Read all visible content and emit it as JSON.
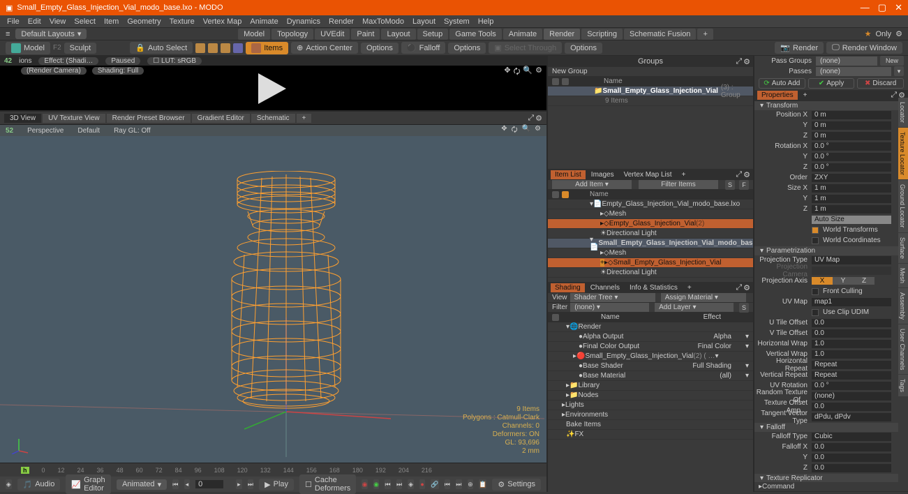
{
  "title": "Small_Empty_Glass_Injection_Vial_modo_base.lxo - MODO",
  "menus": [
    "File",
    "Edit",
    "View",
    "Select",
    "Item",
    "Geometry",
    "Texture",
    "Vertex Map",
    "Animate",
    "Dynamics",
    "Render",
    "MaxToModo",
    "Layout",
    "System",
    "Help"
  ],
  "layout_dropdown": "Default Layouts",
  "layout_tabs": [
    "Model",
    "Topology",
    "UVEdit",
    "Paint",
    "Layout",
    "Setup",
    "Game Tools",
    "Animate",
    "Render",
    "Scripting",
    "Schematic Fusion"
  ],
  "only_btn": "Only",
  "tools": {
    "model": "Model",
    "f2": "F2",
    "sculpt": "Sculpt",
    "auto_select": "Auto Select",
    "items": "Items",
    "action_center": "Action Center",
    "options1": "Options",
    "falloff": "Falloff",
    "options2": "Options",
    "select_through": "Select Through",
    "options3": "Options",
    "render": "Render",
    "render_window": "Render Window"
  },
  "preview": {
    "options_label": "ions",
    "effect": "Effect: (Shadi…",
    "paused": "Paused",
    "lut": "LUT: sRGB",
    "camera": "(Render Camera)",
    "shading": "Shading: Full",
    "counter": "42"
  },
  "view_tabs": [
    "3D View",
    "UV Texture View",
    "Render Preset Browser",
    "Gradient Editor",
    "Schematic"
  ],
  "viewport": {
    "perspective": "Perspective",
    "default": "Default",
    "raygl": "Ray GL: Off",
    "counter": "52",
    "stats": {
      "items": "9 Items",
      "polygons": "Polygons : Catmull-Clark",
      "channels": "Channels: 0",
      "deformers": "Deformers: ON",
      "gl": "GL: 93,696",
      "mem": "2 mm"
    }
  },
  "timeline_ticks": [
    "0",
    "12",
    "24",
    "36",
    "48",
    "60",
    "72",
    "84",
    "96",
    "108",
    "120",
    "132",
    "144",
    "156",
    "168",
    "180",
    "192",
    "204",
    "216"
  ],
  "bottombar": {
    "audio": "Audio",
    "graph": "Graph Editor",
    "animated": "Animated",
    "frame": "0",
    "play": "Play",
    "cache": "Cache Deformers",
    "settings": "Settings"
  },
  "groups": {
    "title": "Groups",
    "new_group": "New Group",
    "name_hdr": "Name",
    "item_name": "Small_Empty_Glass_Injection_Vial",
    "item_suffix": "(3) : Group",
    "item_count": "9 Items"
  },
  "item_tabs": [
    "Item List",
    "Images",
    "Vertex Map List"
  ],
  "item_list": {
    "add": "Add Item",
    "filter": "Filter Items",
    "s": "S",
    "f": "F",
    "name_hdr": "Name",
    "items": [
      {
        "name": "Empty_Glass_Injection_Vial_modo_base.lxo",
        "level": 1,
        "sel": false
      },
      {
        "name": "Mesh",
        "level": 2,
        "sel": false
      },
      {
        "name": "Empty_Glass_Injection_Vial",
        "suffix": "(2)",
        "level": 2,
        "sel": true
      },
      {
        "name": "Directional Light",
        "level": 2,
        "sel": false
      },
      {
        "name": "Small_Empty_Glass_Injection_Vial_modo_base.lxo",
        "level": 1,
        "sel": false,
        "bold": true
      },
      {
        "name": "Mesh",
        "level": 2,
        "sel": false
      },
      {
        "name": "Small_Empty_Glass_Injection_Vial",
        "level": 2,
        "sel": true,
        "hot": true
      },
      {
        "name": "Directional Light",
        "level": 2,
        "sel": false
      }
    ]
  },
  "shade_tabs": [
    "Shading",
    "Channels",
    "Info & Statistics"
  ],
  "shading": {
    "view": "View",
    "shader_tree": "Shader Tree",
    "assign": "Assign Material",
    "filter": "Filter",
    "filter_val": "(none)",
    "add_layer": "Add Layer",
    "s": "S",
    "name": "Name",
    "effect": "Effect",
    "rows": [
      {
        "name": "Render",
        "effect": ""
      },
      {
        "name": "Alpha Output",
        "effect": "Alpha"
      },
      {
        "name": "Final Color Output",
        "effect": "Final Color"
      },
      {
        "name": "Small_Empty_Glass_Injection_Vial",
        "suffix": "(2) ( …",
        "effect": ""
      },
      {
        "name": "Base Shader",
        "effect": "Full Shading"
      },
      {
        "name": "Base Material",
        "effect": "(all)"
      },
      {
        "name": "Library",
        "effect": ""
      },
      {
        "name": "Nodes",
        "effect": ""
      },
      {
        "name": "Lights",
        "effect": ""
      },
      {
        "name": "Environments",
        "effect": ""
      },
      {
        "name": "Bake Items",
        "effect": ""
      },
      {
        "name": "FX",
        "effect": ""
      }
    ]
  },
  "right": {
    "pass_groups": "Pass Groups",
    "pg_val": "(none)",
    "new": "New",
    "passes": "Passes",
    "p_val": "(none)",
    "auto_add": "Auto Add",
    "apply": "Apply",
    "discard": "Discard",
    "properties": "Properties",
    "transform": "Transform",
    "pos": {
      "label": "Position X",
      "x": "0 m",
      "y": "0 m",
      "z": "0 m"
    },
    "rot": {
      "label": "Rotation X",
      "x": "0.0 °",
      "y": "0.0 °",
      "z": "0.0 °"
    },
    "order": "Order",
    "order_val": "ZXY",
    "size": {
      "label": "Size X",
      "x": "1 m",
      "y": "1 m",
      "z": "1 m"
    },
    "auto_size": "Auto Size",
    "world_transforms": "World Transforms",
    "world_coords": "World Coordinates",
    "parametrization": "Parametrization",
    "proj_type": "Projection Type",
    "proj_type_val": "UV Map",
    "proj_camera": "Projection Camera",
    "proj_axis": "Projection Axis",
    "axis_x": "X",
    "axis_y": "Y",
    "axis_z": "Z",
    "front_culling": "Front Culling",
    "uv_map": "UV Map",
    "uv_map_val": "map1",
    "use_clip": "Use Clip UDIM",
    "u_tile": "U Tile Offset",
    "u_tile_val": "0.0",
    "v_tile": "V Tile Offset",
    "v_tile_val": "0.0",
    "h_wrap": "Horizontal Wrap",
    "h_wrap_val": "1.0",
    "v_wrap": "Vertical Wrap",
    "v_wrap_val": "1.0",
    "h_repeat": "Horizontal Repeat",
    "h_repeat_val": "Repeat",
    "v_repeat": "Vertical Repeat",
    "v_repeat_val": "Repeat",
    "uv_rot": "UV Rotation",
    "uv_rot_val": "0.0 °",
    "rand_tex": "Random Texture Of…",
    "rand_tex_val": "(none)",
    "tex_offset": "Texture Offset Amp…",
    "tex_offset_val": "0.0",
    "tan_vec": "Tangent Vector Type",
    "tan_vec_val": "dPdu, dPdv",
    "falloff": "Falloff",
    "falloff_type": "Falloff Type",
    "falloff_type_val": "Cubic",
    "falloff_x": "Falloff X",
    "fx": "0.0",
    "fy": "0.0",
    "fz": "0.0",
    "tex_rep": "Texture Replicator",
    "command": "Command"
  },
  "side_tabs": [
    "Locator",
    "Texture Locator",
    "Ground Locator",
    "Surface",
    "Mesh",
    "Assembly",
    "User Channels",
    "Tags"
  ]
}
